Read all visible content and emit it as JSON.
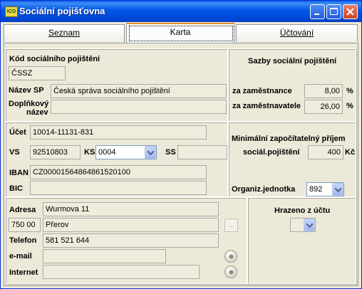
{
  "window": {
    "title": "Sociální pojišťovna",
    "icon": "ico-icon",
    "icon_text": "ICO"
  },
  "tabs": [
    {
      "label": "Seznam"
    },
    {
      "label": "Karta"
    },
    {
      "label": "Účtování"
    }
  ],
  "form": {
    "kod_label": "Kód sociálního pojištění",
    "kod_value": "ČSSZ",
    "nazev_label": "Název SP",
    "nazev_value": "Česká správa sociálního pojištění",
    "doplnkovy_label_1": "Doplňkový",
    "doplnkovy_label_2": "název",
    "doplnkovy_value": "",
    "ucet_label": "Účet",
    "ucet_value": "10014-11131-831",
    "vs_label": "VS",
    "vs_value": "92510803",
    "ks_label": "KS",
    "ks_value": "0004",
    "ss_label": "SS",
    "ss_value": "",
    "iban_label": "IBAN",
    "iban_value": "CZ0000156486486152010 0",
    "iban_value_exact": "CZ00001564864861520100",
    "bic_label": "BIC",
    "bic_value": "",
    "adresa_label": "Adresa",
    "adresa_value": "Wurmova 11",
    "psc_value": "750 00",
    "mesto_value": "Přerov",
    "telefon_label": "Telefon",
    "telefon_value": "581 521 644",
    "email_label": "e-mail",
    "email_value": "",
    "internet_label": "Internet",
    "internet_value": "",
    "dots_button": "..."
  },
  "sazby": {
    "title": "Sazby sociální pojištění",
    "zamestnance_label": "za zaměstnance",
    "zamestnance_value": "8,00",
    "zamestnavatele_label": "za zaměstnavatele",
    "zamestnavatele_value": "26,00",
    "percent": "%"
  },
  "minimalni": {
    "title": "Minimální započítatelný příjem",
    "label": "sociál.pojištění",
    "value": "400",
    "unit": "Kč"
  },
  "organiz": {
    "label": "Organiz.jednotka",
    "value": "892"
  },
  "hrazeno": {
    "label": "Hrazeno z účtu",
    "value": ""
  }
}
